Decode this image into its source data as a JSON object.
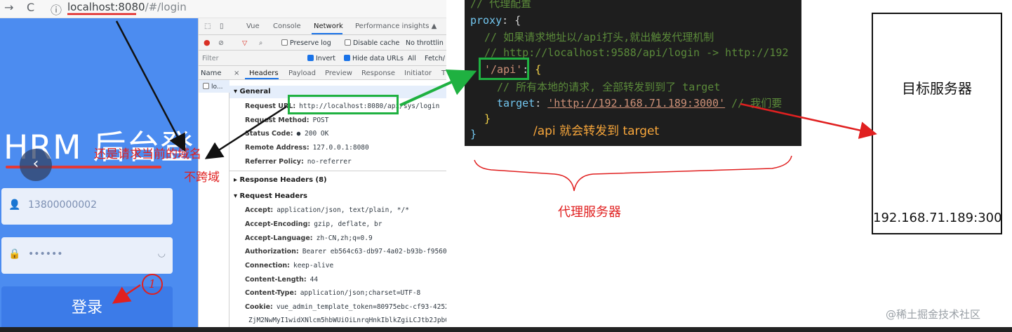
{
  "browser": {
    "back": "→",
    "reload": "C",
    "info": "ⓘ",
    "address_host": "localhost:8080",
    "address_rest": "/#/login"
  },
  "login": {
    "title": "HRM 后台登",
    "back_glyph": "‹",
    "phone_value": "13800000002",
    "password_value": "••••••",
    "login_button": "登录",
    "annotation_line1": "还是请求当前的域名",
    "annotation_line2": "不跨域",
    "circle_number": "1"
  },
  "devtools": {
    "tabs": [
      "Vue",
      "Console",
      "Network",
      "Performance insights ▲"
    ],
    "row2": {
      "preserve_log": "Preserve log",
      "disable_cache": "Disable cache",
      "throttling": "No throttlin"
    },
    "row3": {
      "filter": "Filter",
      "invert": "Invert",
      "hide_data_urls": "Hide data URLs",
      "all": "All",
      "fetch": "Fetch/"
    },
    "name_header": "Name",
    "name_row": "lo...",
    "detail_tabs": [
      "×",
      "Headers",
      "Payload",
      "Preview",
      "Response",
      "Initiator",
      "T"
    ],
    "general_header": "▾ General",
    "general": [
      {
        "key": "Request URL:",
        "value": "http://localhost:8080/api/sys/login"
      },
      {
        "key": "Request Method:",
        "value": "POST"
      },
      {
        "key": "Status Code:",
        "value": "● 200 OK"
      },
      {
        "key": "Remote Address:",
        "value": "127.0.0.1:8080"
      },
      {
        "key": "Referrer Policy:",
        "value": "no-referrer"
      }
    ],
    "response_headers": "▸ Response Headers (8)",
    "request_headers": "▾ Request Headers",
    "request": [
      {
        "key": "Accept:",
        "value": "application/json, text/plain, */*"
      },
      {
        "key": "Accept-Encoding:",
        "value": "gzip, deflate, br"
      },
      {
        "key": "Accept-Language:",
        "value": "zh-CN,zh;q=0.9"
      },
      {
        "key": "Authorization:",
        "value": "Bearer eb564c63-db97-4a02-b93b-f95601"
      },
      {
        "key": "Connection:",
        "value": "keep-alive"
      },
      {
        "key": "Content-Length:",
        "value": "44"
      },
      {
        "key": "Content-Type:",
        "value": "application/json;charset=UTF-8"
      },
      {
        "key": "Cookie:",
        "value": "vue_admin_template_token=80975ebc-cf93-4252"
      },
      {
        "key": "",
        "value": "ZjM2NwMyI1widXNlcm5hbWUiOiLnrqHnkIblkZgiLCJtb2JpbG"
      }
    ]
  },
  "code": {
    "line0": "// 代理配置",
    "line1_key": "proxy",
    "line2": "// 如果请求地址以/api打头,就出触发代理机制",
    "line3": "// http://localhost:9588/api/login -> http://192",
    "line4_str": "'/api'",
    "line5": "// 所有本地的请求, 全部转发到到了 target",
    "line6_key": "target",
    "line6_str": "'http://192.168.71.189:3000'",
    "line6_comment": "// 我们要",
    "note": "/api 就会转发到 target",
    "proxy_label": "代理服务器"
  },
  "server": {
    "title": "目标服务器",
    "ip": "192.168.71.189:300"
  },
  "watermark": "@稀土掘金技术社区"
}
